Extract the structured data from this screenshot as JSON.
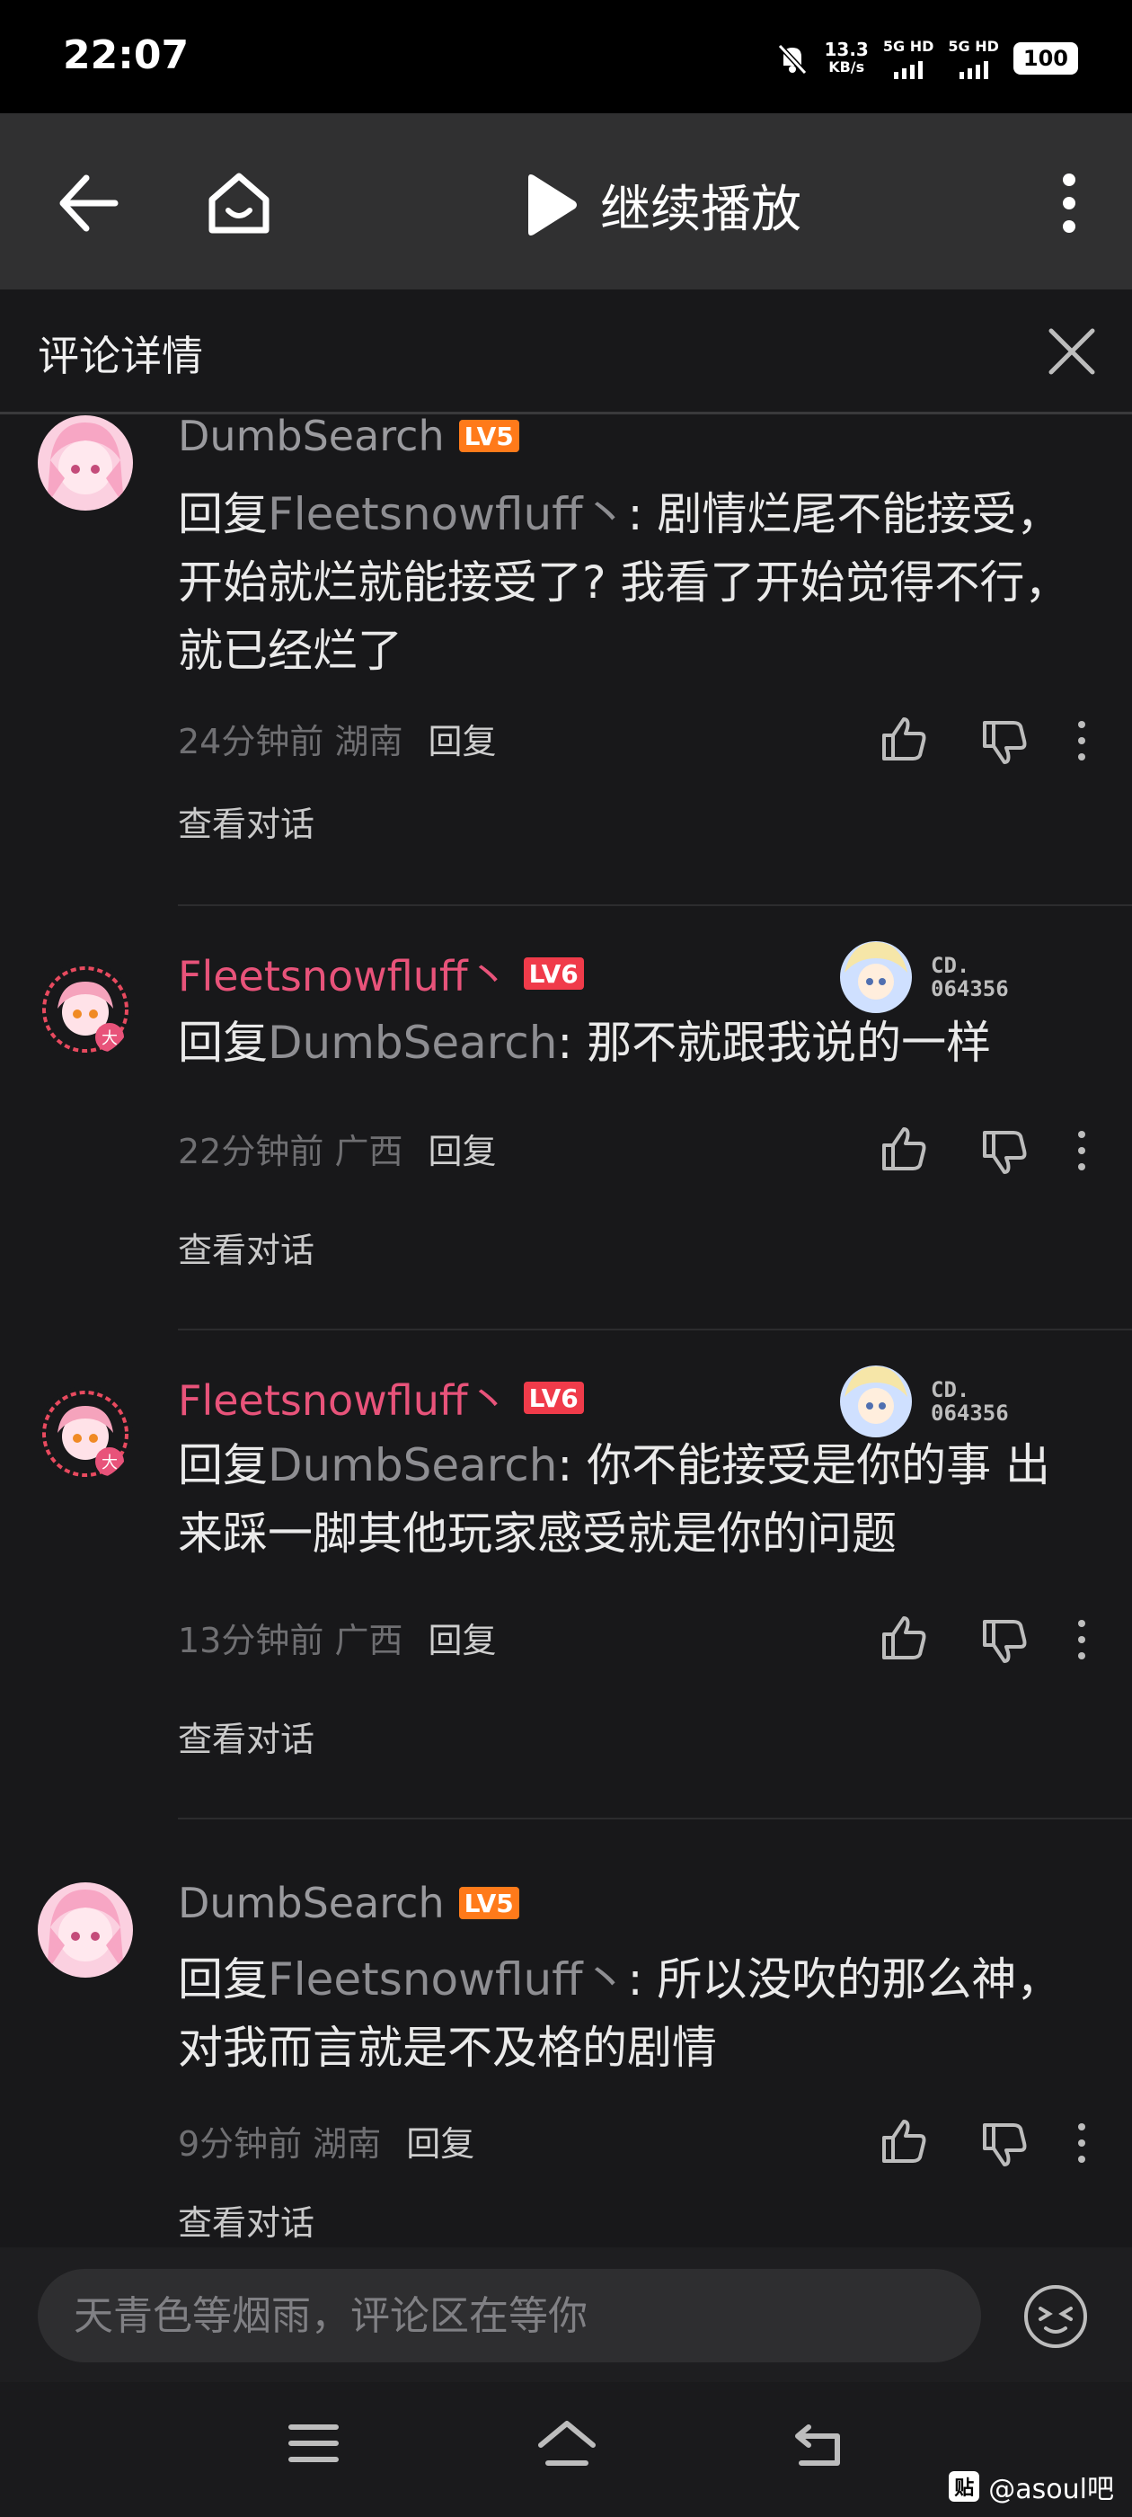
{
  "status_bar": {
    "time": "22:07",
    "speed_value": "13.3",
    "speed_unit": "KB/s",
    "net1": "5G HD",
    "net2": "5G HD",
    "battery": "100"
  },
  "top_bar": {
    "play_label": "继续播放",
    "icons": [
      "back-arrow-icon",
      "home-icon",
      "play-icon",
      "more-vertical-icon"
    ]
  },
  "comment_header": {
    "title": "评论详情"
  },
  "comments": [
    {
      "username": "DumbSearch",
      "level": "LV5",
      "reply_prefix": "回复",
      "reply_to": "Fleetsnowfluff丶",
      "text": ": 剧情烂尾不能接受，开始就烂就能接受了? 我看了开始觉得不行，就已经烂了",
      "time": "24分钟前",
      "location": "湖南",
      "reply_label": "回复",
      "view_conversation": "查看对话"
    },
    {
      "username": "Fleetsnowfluff丶",
      "level": "LV6",
      "badge_line1": "CD.",
      "badge_line2": "064356",
      "reply_prefix": "回复",
      "reply_to": "DumbSearch",
      "text": ": 那不就跟我说的一样",
      "time": "22分钟前",
      "location": "广西",
      "reply_label": "回复",
      "view_conversation": "查看对话"
    },
    {
      "username": "Fleetsnowfluff丶",
      "level": "LV6",
      "badge_line1": "CD.",
      "badge_line2": "064356",
      "reply_prefix": "回复",
      "reply_to": "DumbSearch",
      "text": ": 你不能接受是你的事 出来踩一脚其他玩家感受就是你的问题",
      "time": "13分钟前",
      "location": "广西",
      "reply_label": "回复",
      "view_conversation": "查看对话"
    },
    {
      "username": "DumbSearch",
      "level": "LV5",
      "reply_prefix": "回复",
      "reply_to": "Fleetsnowfluff丶",
      "text": ": 所以没吹的那么神，对我而言就是不及格的剧情",
      "time": "9分钟前",
      "location": "湖南",
      "reply_label": "回复",
      "view_conversation": "查看对话"
    }
  ],
  "input": {
    "placeholder": "天青色等烟雨，评论区在等你"
  },
  "nav_bar": {
    "watermark_icon_text": "贴",
    "watermark_text": "@asoul吧"
  },
  "colors": {
    "accent_pink": "#e8537a",
    "level5": "#ff7a1a",
    "level6": "#f03b4a",
    "background": "#18181a"
  }
}
